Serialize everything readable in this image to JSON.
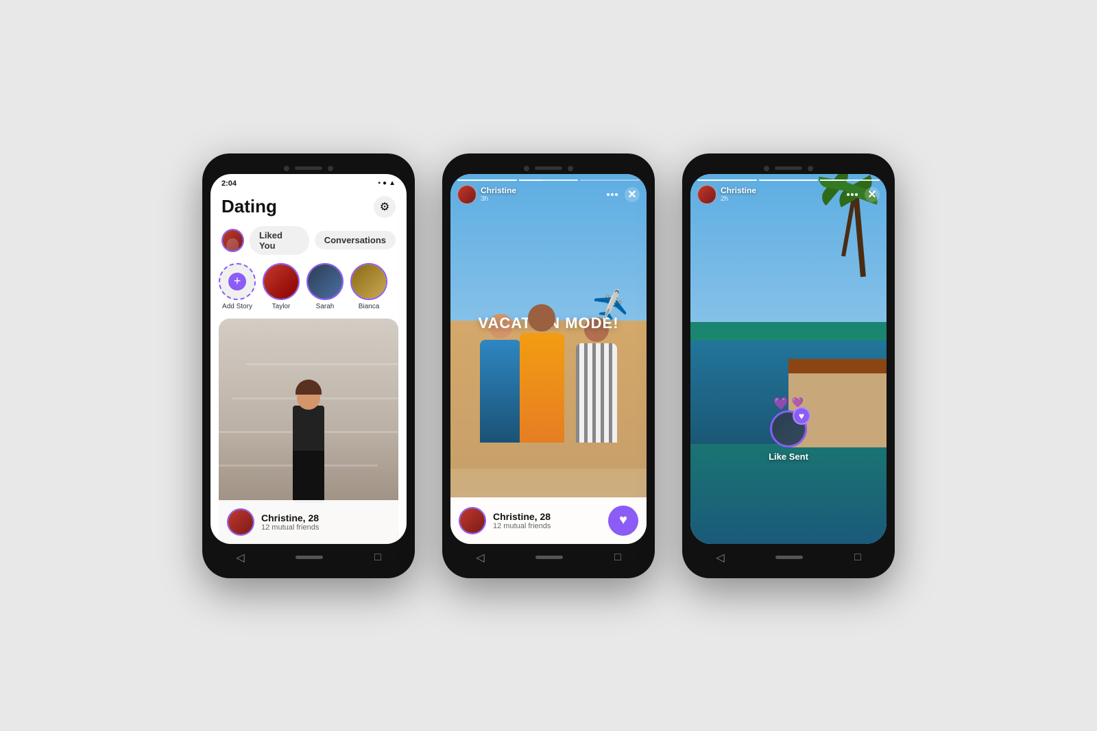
{
  "background": "#e2e2e2",
  "phones": [
    {
      "id": "phone1",
      "screen": "dating_home",
      "status_time": "2:04",
      "title": "Dating",
      "tabs": [
        {
          "label": "Liked You",
          "active": false
        },
        {
          "label": "Conversations",
          "active": false
        }
      ],
      "stories": [
        {
          "label": "Add Story",
          "type": "add"
        },
        {
          "label": "Taylor",
          "type": "user"
        },
        {
          "label": "Sarah",
          "type": "user"
        },
        {
          "label": "Bianca",
          "type": "user"
        }
      ],
      "card": {
        "name": "Christine, 28",
        "mutual": "12 mutual friends"
      }
    },
    {
      "id": "phone2",
      "screen": "story_view",
      "user_name": "Christine",
      "time_ago": "3h",
      "vacation_text": "VACATION MODE!",
      "card": {
        "name": "Christine, 28",
        "mutual": "12 mutual friends"
      }
    },
    {
      "id": "phone3",
      "screen": "like_sent",
      "user_name": "Christine",
      "time_ago": "2h",
      "like_sent_label": "Like Sent"
    }
  ],
  "icons": {
    "gear": "⚙",
    "plus": "+",
    "heart": "♥",
    "close": "✕",
    "back": "◁",
    "home": "□",
    "airplane": "✈"
  }
}
